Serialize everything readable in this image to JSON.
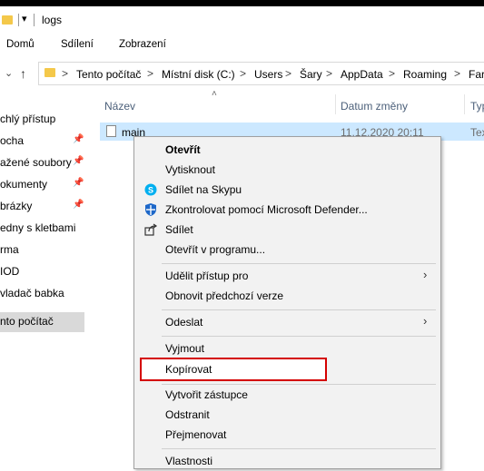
{
  "title_bar": {
    "title": "logs",
    "folder_icon": "folder-icon",
    "quick_access_icon": "dropdown-arrow-icon"
  },
  "ribbon": {
    "tabs": [
      "Domů",
      "Sdílení",
      "Zobrazení"
    ]
  },
  "address_bar": {
    "crumbs": [
      "Tento počítač",
      "Místní disk (C:)",
      "Users",
      "Šary",
      "AppData",
      "Roaming",
      "Farm"
    ],
    "separator": ">"
  },
  "navigation": {
    "items": [
      {
        "label": "chlý přístup",
        "pinned": false
      },
      {
        "label": "ocha",
        "pinned": true
      },
      {
        "label": "ažené soubory",
        "pinned": true
      },
      {
        "label": "okumenty",
        "pinned": true
      },
      {
        "label": "brázky",
        "pinned": true
      },
      {
        "label": "edny s kletbami",
        "pinned": false
      },
      {
        "label": "rma",
        "pinned": false
      },
      {
        "label": "IOD",
        "pinned": false
      },
      {
        "label": "vladač babka",
        "pinned": false
      },
      {
        "label": "nto počítač",
        "pinned": false,
        "selected": true
      }
    ]
  },
  "columns": {
    "name": "Název",
    "date": "Datum změny",
    "type": "Typ"
  },
  "file": {
    "name": "main",
    "date": "11.12.2020 20:11",
    "type": "Tex"
  },
  "context_menu": {
    "groups": [
      [
        {
          "label": "Otevřít",
          "bold": true
        },
        {
          "label": "Vytisknout"
        },
        {
          "label": "Sdílet na Skypu",
          "icon": "skype-icon"
        },
        {
          "label": "Zkontrolovat pomocí Microsoft Defender...",
          "icon": "defender-icon"
        },
        {
          "label": "Sdílet",
          "icon": "share-icon"
        },
        {
          "label": "Otevřít v programu..."
        }
      ],
      [
        {
          "label": "Udělit přístup pro",
          "submenu": true
        },
        {
          "label": "Obnovit předchozí verze"
        }
      ],
      [
        {
          "label": "Odeslat",
          "submenu": true
        }
      ],
      [
        {
          "label": "Vyjmout"
        },
        {
          "label": "Kopírovat",
          "highlighted": true
        }
      ],
      [
        {
          "label": "Vytvořit zástupce"
        },
        {
          "label": "Odstranit"
        },
        {
          "label": "Přejmenovat"
        }
      ],
      [
        {
          "label": "Vlastnosti"
        }
      ]
    ]
  },
  "colors": {
    "selection": "#cce8ff",
    "menu_background": "#f2f2f2",
    "highlight_box": "#d40000",
    "nav_selected": "#d9d9d9"
  }
}
